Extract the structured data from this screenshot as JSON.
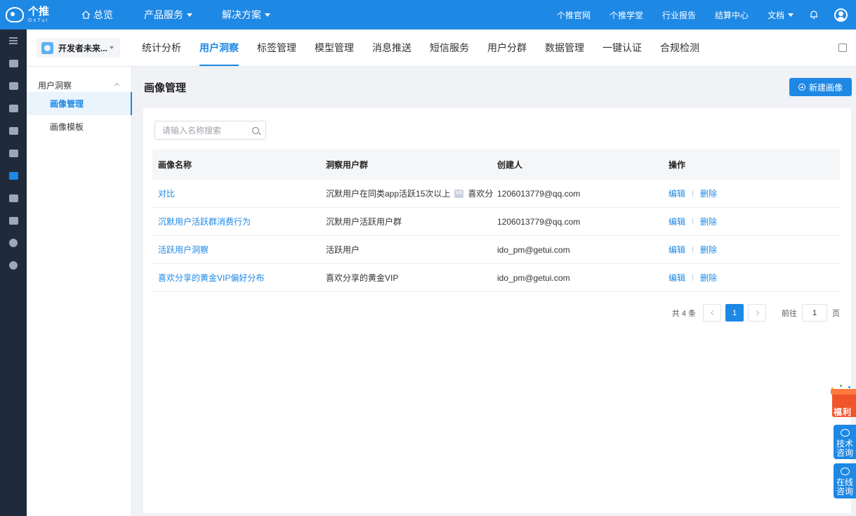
{
  "topbar": {
    "logo_cn": "个推",
    "logo_en": "GeTuI",
    "nav": [
      {
        "label": "总览"
      },
      {
        "label": "产品服务"
      },
      {
        "label": "解决方案"
      }
    ],
    "links": [
      "个推官网",
      "个推学堂",
      "行业报告",
      "结算中心"
    ],
    "docs_label": "文档"
  },
  "colors": {
    "primary": "#1e88e5",
    "sidebar_bg": "#1f2b3a",
    "gift": "#f0542b"
  },
  "app_selector": {
    "label": "开发者未来..."
  },
  "subnav": [
    {
      "label": "统计分析"
    },
    {
      "label": "用户洞察"
    },
    {
      "label": "标签管理"
    },
    {
      "label": "模型管理"
    },
    {
      "label": "消息推送"
    },
    {
      "label": "短信服务"
    },
    {
      "label": "用户分群"
    },
    {
      "label": "数据管理"
    },
    {
      "label": "一键认证"
    },
    {
      "label": "合规检测"
    }
  ],
  "iconbar": [
    "user-stats-icon",
    "report-icon",
    "tag-icon",
    "message-icon",
    "chart-icon",
    "user-insight-icon",
    "push-icon",
    "data-icon",
    "auth-icon",
    "check-icon"
  ],
  "submenu": {
    "group": "用户洞察",
    "items": [
      {
        "label": "画像管理"
      },
      {
        "label": "画像模板"
      }
    ]
  },
  "page": {
    "title": "画像管理",
    "new_button": "新建画像"
  },
  "search": {
    "placeholder": "请输入名称搜索",
    "value": ""
  },
  "table": {
    "columns": [
      "画像名称",
      "洞察用户群",
      "创建人",
      "操作"
    ],
    "rows": [
      {
        "name": "对比",
        "group": "沉默用户在同类app活跃15次以上",
        "vs": "VS",
        "group2": "喜欢分",
        "creator": "1206013779@qq.com"
      },
      {
        "name": "沉默用户活跃群消费行为",
        "group": "沉默用户活跃用户群",
        "creator": "1206013779@qq.com"
      },
      {
        "name": "活跃用户洞察",
        "group": "活跃用户",
        "creator": "ido_pm@getui.com"
      },
      {
        "name": "喜欢分享的黄金VIP偏好分布",
        "group": "喜欢分享的黄金VIP",
        "creator": "ido_pm@getui.com"
      }
    ],
    "edit_label": "编辑",
    "delete_label": "删除"
  },
  "pagination": {
    "total": "共 4 条",
    "current_page": "1",
    "goto_label": "前往",
    "goto_value": "1",
    "unit": "页"
  },
  "float": {
    "gift": "福利",
    "tech": "技术咨询",
    "online": "在线咨询"
  }
}
